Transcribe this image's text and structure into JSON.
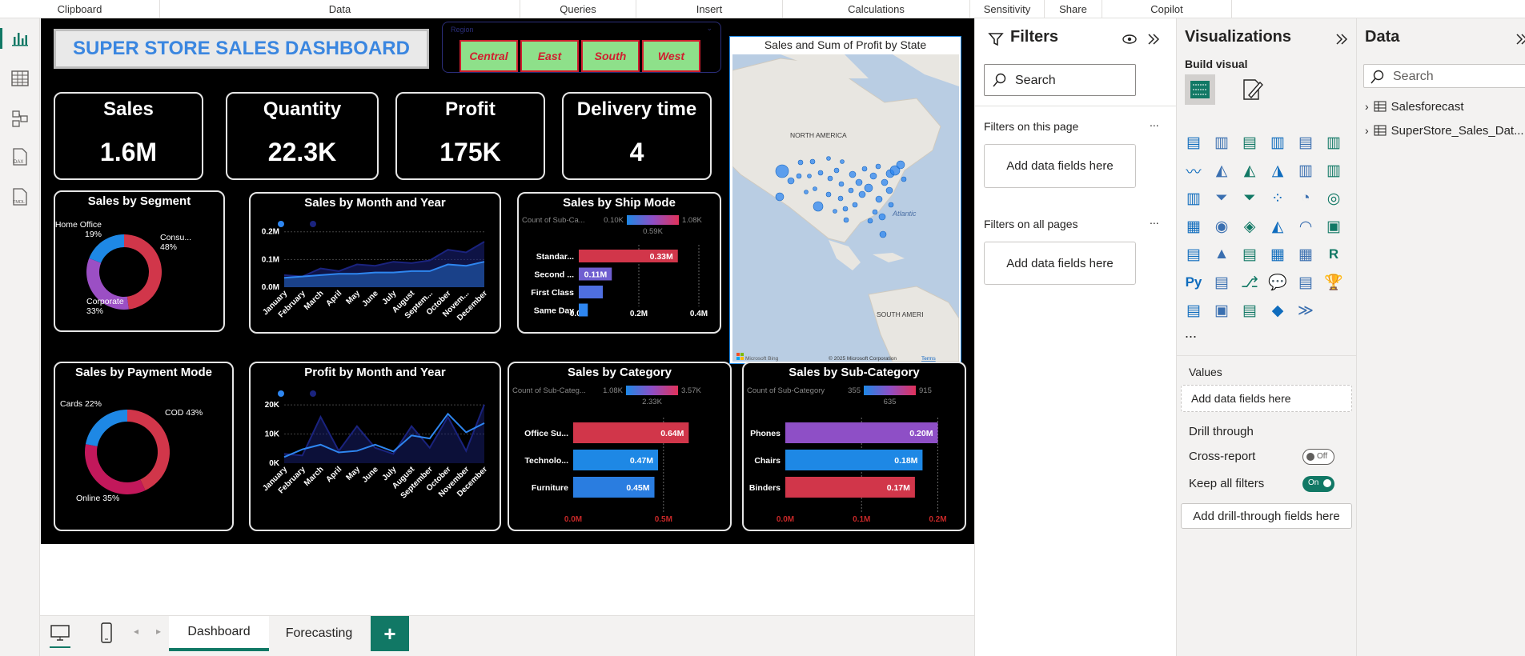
{
  "ribbon": {
    "groups": [
      "Clipboard",
      "Data",
      "Queries",
      "Insert",
      "Calculations",
      "Sensitivity",
      "Share",
      "Copilot"
    ]
  },
  "report": {
    "title": "SUPER STORE SALES DASHBOARD",
    "region_slicer": {
      "label": "Region",
      "options": [
        "Central",
        "East",
        "South",
        "West"
      ]
    },
    "kpis": [
      {
        "label": "Sales",
        "value": "1.6M"
      },
      {
        "label": "Quantity",
        "value": "22.3K"
      },
      {
        "label": "Profit",
        "value": "175K"
      },
      {
        "label": "Delivery time",
        "value": "4"
      }
    ],
    "map": {
      "title": "Sales and Sum of Profit by State",
      "labels": [
        "NORTH AMERICA",
        "Atlantic",
        "SOUTH AMERI"
      ],
      "attribution": "© 2025 Microsoft Corporation",
      "terms": "Terms",
      "bing": "Microsoft Bing"
    }
  },
  "chart_data": [
    {
      "id": "segment",
      "type": "pie",
      "title": "Sales by Segment",
      "categories": [
        "Consu...",
        "Corporate",
        "Home Office"
      ],
      "values": [
        48,
        33,
        19
      ],
      "labels": [
        "Consu...\n48%",
        "Corporate\n33%",
        "Home Office\n19%"
      ],
      "colors": [
        "#d1364a",
        "#9b4fc4",
        "#1e88e5"
      ]
    },
    {
      "id": "payment",
      "type": "pie",
      "title": "Sales by Payment Mode",
      "categories": [
        "COD",
        "Online",
        "Cards"
      ],
      "values": [
        43,
        35,
        22
      ],
      "labels": [
        "COD 43%",
        "Online 35%",
        "Cards 22%"
      ],
      "colors": [
        "#d1364a",
        "#c2185b",
        "#1e88e5"
      ]
    },
    {
      "id": "sales_month",
      "type": "area",
      "title": "Sales by Month and Year",
      "categories": [
        "January",
        "February",
        "March",
        "April",
        "May",
        "June",
        "July",
        "August",
        "Septem...",
        "October",
        "Novem...",
        "December"
      ],
      "series": [
        {
          "values": [
            0.035,
            0.04,
            0.045,
            0.05,
            0.05,
            0.055,
            0.055,
            0.06,
            0.06,
            0.085,
            0.08,
            0.095
          ]
        },
        {
          "values": [
            0.045,
            0.04,
            0.07,
            0.06,
            0.085,
            0.08,
            0.095,
            0.09,
            0.1,
            0.14,
            0.13,
            0.17
          ]
        }
      ],
      "yticks": [
        "0.0M",
        "0.1M",
        "0.2M"
      ],
      "ylim": [
        0,
        0.23
      ],
      "colors": [
        "#2e86f0",
        "#1a237e"
      ]
    },
    {
      "id": "ship_mode",
      "type": "bar",
      "title": "Sales by Ship Mode",
      "legend_title": "Count of Sub-Ca...",
      "legend_min": "0.10K",
      "legend_max": "1.08K",
      "legend_mid": "0.59K",
      "categories": [
        "Standar...",
        "Second ...",
        "First Class",
        "Same Day"
      ],
      "values": [
        0.33,
        0.11,
        0.08,
        0.03
      ],
      "data_labels": [
        "0.33M",
        "0.11M",
        "",
        ""
      ],
      "xticks": [
        "0.0M",
        "0.2M",
        "0.4M"
      ],
      "xlim": [
        0,
        0.4
      ],
      "colors": [
        "#d1364a",
        "#6f5fd0",
        "#4f6fe0",
        "#2e86f0"
      ]
    },
    {
      "id": "profit_month",
      "type": "line",
      "title": "Profit by Month and Year",
      "categories": [
        "January",
        "February",
        "March",
        "April",
        "May",
        "June",
        "July",
        "August",
        "September",
        "October",
        "November",
        "December"
      ],
      "series": [
        {
          "values": [
            2000,
            4500,
            6000,
            3500,
            4000,
            6000,
            3800,
            9000,
            8000,
            16000,
            10000,
            13000
          ]
        },
        {
          "values": [
            3000,
            2500,
            15000,
            4000,
            12000,
            5000,
            3000,
            12000,
            5000,
            15000,
            4000,
            19000
          ]
        }
      ],
      "yticks": [
        "0K",
        "10K",
        "20K"
      ],
      "ylim": [
        0,
        21000
      ],
      "colors": [
        "#2e86f0",
        "#1a237e"
      ]
    },
    {
      "id": "category",
      "type": "bar",
      "title": "Sales by Category",
      "legend_title": "Count of Sub-Categ...",
      "legend_min": "1.08K",
      "legend_max": "3.57K",
      "legend_mid": "2.33K",
      "categories": [
        "Office Su...",
        "Technolo...",
        "Furniture"
      ],
      "values": [
        0.64,
        0.47,
        0.45
      ],
      "data_labels": [
        "0.64M",
        "0.47M",
        "0.45M"
      ],
      "xticks": [
        "0.0M",
        "0.5M"
      ],
      "xlim": [
        0,
        0.82
      ],
      "colors": [
        "#d1364a",
        "#1e88e5",
        "#2a7de0"
      ]
    },
    {
      "id": "subcategory",
      "type": "bar",
      "title": "Sales by Sub-Category",
      "legend_title": "Count of Sub-Category",
      "legend_min": "355",
      "legend_max": "915",
      "legend_mid": "635",
      "categories": [
        "Phones",
        "Chairs",
        "Binders"
      ],
      "values": [
        0.2,
        0.18,
        0.17
      ],
      "data_labels": [
        "0.20M",
        "0.18M",
        "0.17M"
      ],
      "xticks": [
        "0.0M",
        "0.1M",
        "0.2M"
      ],
      "xlim": [
        0,
        0.21
      ],
      "colors": [
        "#8e4fc6",
        "#1e88e5",
        "#d1364a"
      ]
    }
  ],
  "filters_pane": {
    "title": "Filters",
    "search_placeholder": "Search",
    "on_this_page": "Filters on this page",
    "on_all_pages": "Filters on all pages",
    "add_fields": "Add data fields here",
    "more": "..."
  },
  "viz_pane": {
    "title": "Visualizations",
    "build_visual": "Build visual",
    "more": "...",
    "values_label": "Values",
    "add_fields": "Add data fields here",
    "drill_through": "Drill through",
    "cross_report": "Cross-report",
    "cross_report_state": "Off",
    "keep_filters": "Keep all filters",
    "keep_filters_state": "On",
    "add_drill": "Add drill-through fields here",
    "icons": [
      "stacked-bar",
      "stacked-column",
      "clustered-bar",
      "clustered-column",
      "100-bar",
      "100-column",
      "line",
      "area",
      "stacked-area",
      "ribbon",
      "line-column",
      "line-clustered-column",
      "waterfall",
      "funnel",
      "funnel2",
      "scatter",
      "pie",
      "donut",
      "treemap",
      "map",
      "filled-map",
      "azure-map",
      "gauge",
      "card",
      "multi-row-card",
      "kpi",
      "slicer",
      "table",
      "matrix",
      "r-visual",
      "python-visual",
      "key-influencers",
      "decomposition-tree",
      "qa",
      "smart-narrative",
      "metrics",
      "paginated",
      "card-new",
      "slicer-new",
      "power-apps",
      "power-automate",
      "more-visuals"
    ]
  },
  "data_pane": {
    "title": "Data",
    "search_placeholder": "Search",
    "tables": [
      "Salesforecast",
      "SuperStore_Sales_Dat..."
    ]
  },
  "tabs": {
    "pages": [
      "Dashboard",
      "Forecasting"
    ],
    "add": "+"
  }
}
